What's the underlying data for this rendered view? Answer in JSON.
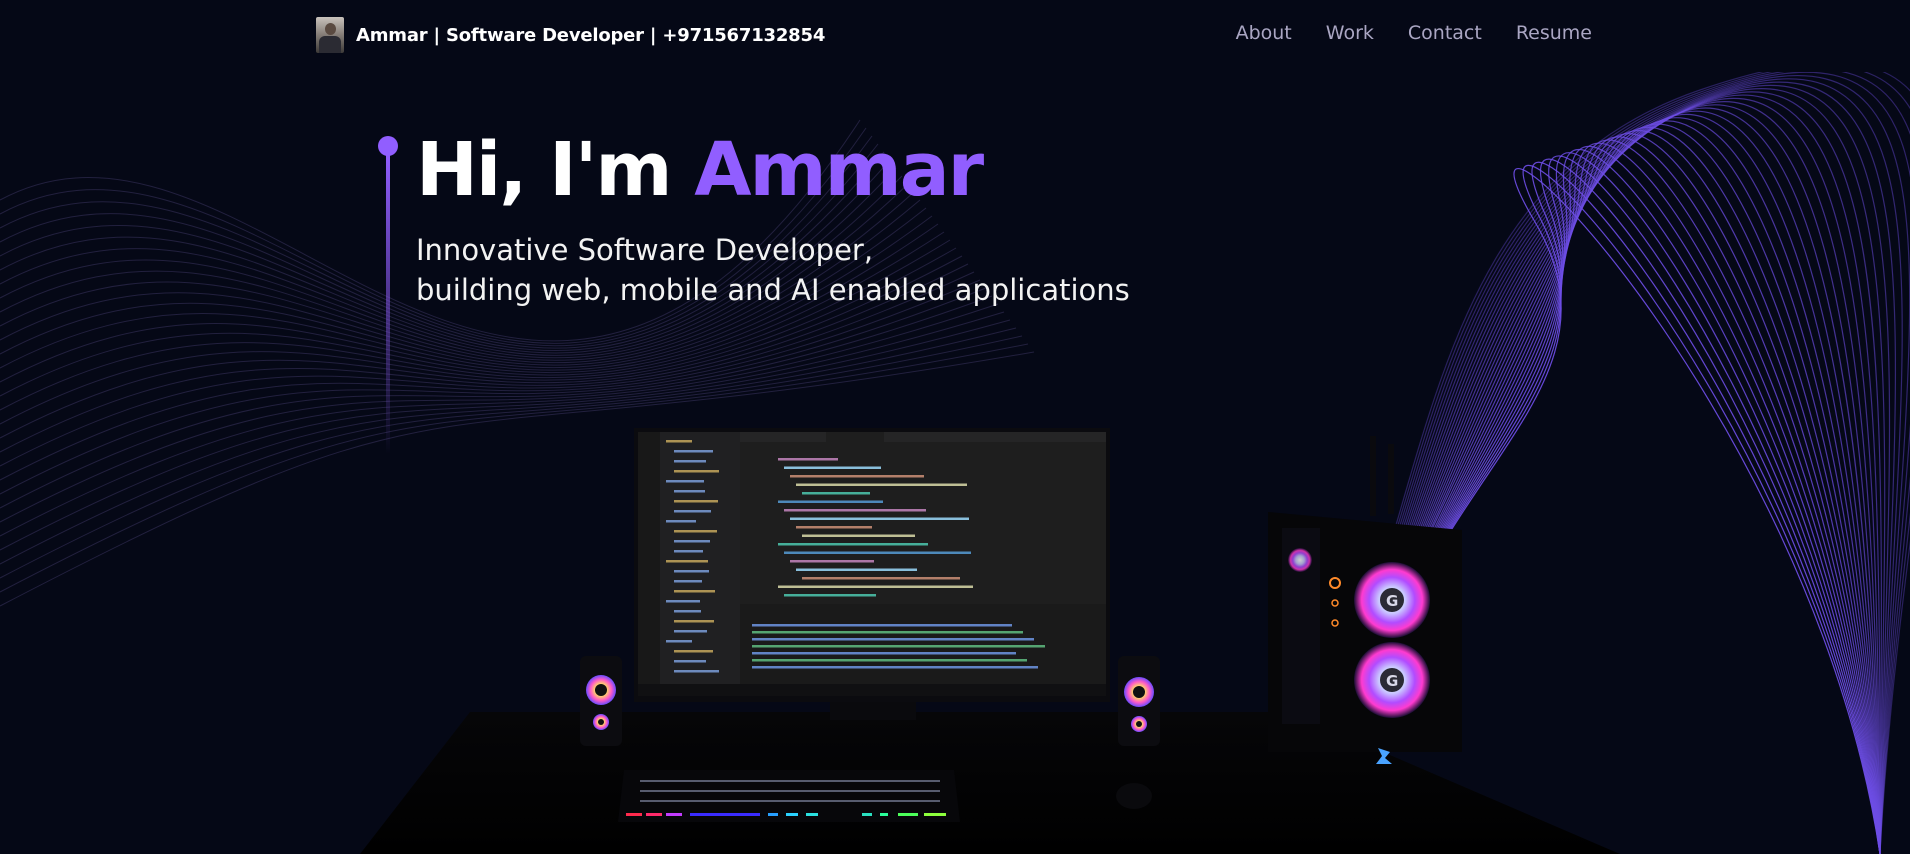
{
  "navbar": {
    "avatar_icon": "profile-photo",
    "brand_text": "Ammar  | Software Developer | +971567132854",
    "links": [
      "About",
      "Work",
      "Contact",
      "Resume"
    ]
  },
  "hero": {
    "title_prefix": "Hi, I'm ",
    "title_name": "Ammar",
    "subtitle_line1": "Innovative Software Developer,",
    "subtitle_line2": "building web, mobile and AI enabled applications"
  },
  "colors": {
    "background": "#050816",
    "accent": "#915eff",
    "nav_text": "#aaa6c3"
  }
}
